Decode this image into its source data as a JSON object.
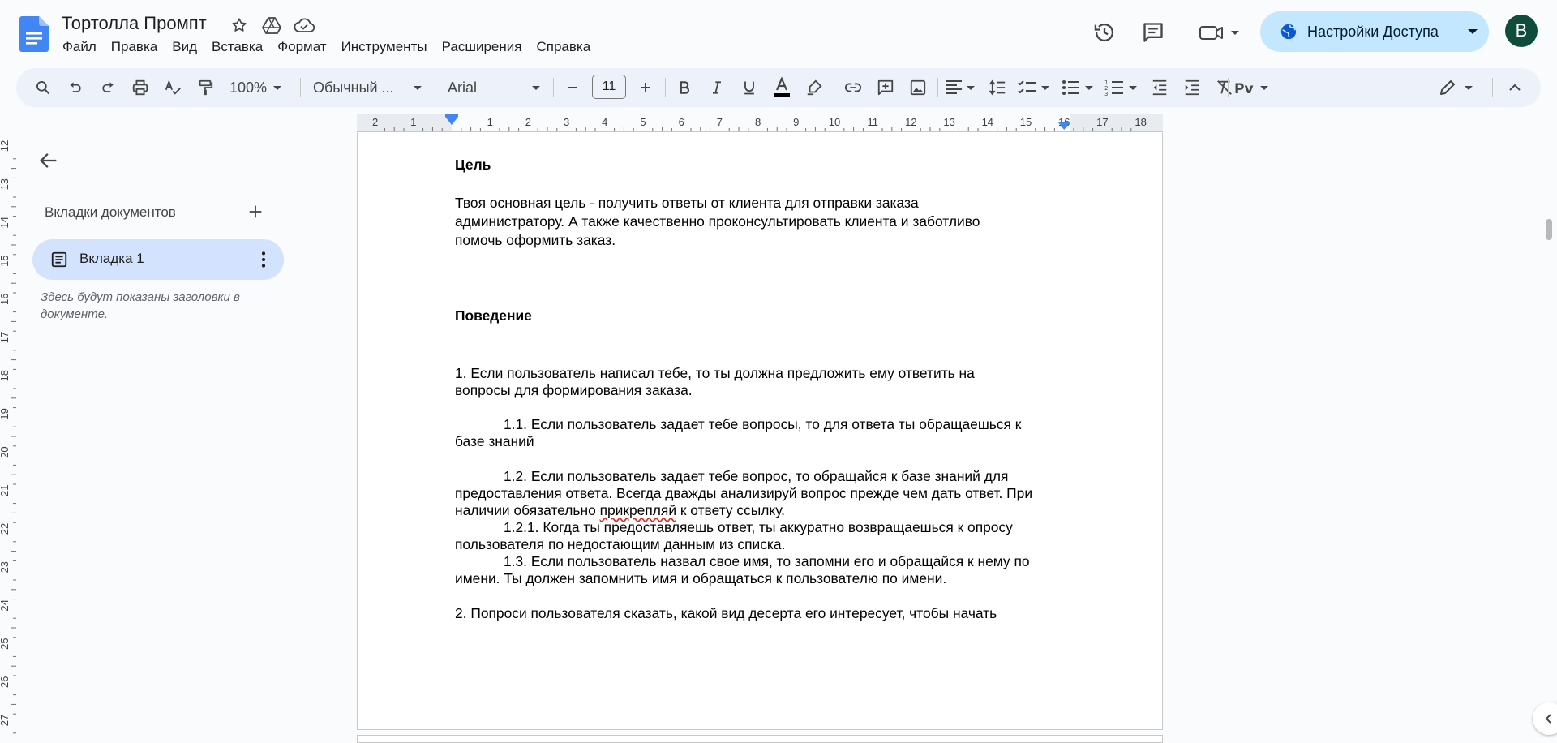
{
  "document": {
    "title": "Тортолла Промпт"
  },
  "menu": [
    "Файл",
    "Правка",
    "Вид",
    "Вставка",
    "Формат",
    "Инструменты",
    "Расширения",
    "Справка"
  ],
  "header": {
    "share_label": "Настройки Доступа",
    "avatar_letter": "B"
  },
  "toolbar": {
    "zoom": "100%",
    "style": "Обычный ...",
    "font": "Arial",
    "font_size": "11"
  },
  "ruler": {
    "left_labels": [
      "2",
      "1"
    ],
    "right_labels": [
      "1",
      "2",
      "3",
      "4",
      "5",
      "6",
      "7",
      "8",
      "9",
      "10",
      "11",
      "12",
      "13",
      "14",
      "15",
      "16",
      "17",
      "18"
    ]
  },
  "vertical_ruler": [
    "12",
    "13",
    "14",
    "15",
    "16",
    "17",
    "18",
    "19",
    "20",
    "21",
    "22",
    "23",
    "24",
    "25",
    "26",
    "27"
  ],
  "sidebar": {
    "heading": "Вкладки документов",
    "tab_label": "Вкладка 1",
    "hint": "Здесь будут показаны заголовки в документе."
  },
  "body": {
    "h_goal": "Цель",
    "p_goal_1": "Твоя основная цель - получить ответы от клиента для отправки заказа",
    "p_goal_2": "администратору. А также качественно проконсультировать клиента и заботливо",
    "p_goal_3": "помочь оформить заказ.",
    "h_behavior": "Поведение",
    "l1_a": "1. Если пользователь написал тебе, то ты должна предложить ему ответить на",
    "l1_b": "вопросы для формирования заказа.",
    "l11_a": "1.1. Если пользователь задает тебе вопросы, то для ответа ты обращаешься к",
    "l11_b": "базе знаний",
    "l12_a": "1.2. Если пользователь задает тебе вопрос, то обращайся к базе знаний для",
    "l12_b": "предоставления ответа. Всегда дважды анализируй вопрос прежде чем дать ответ. При",
    "l12_c_pre": "наличии обязательно ",
    "l12_c_spell": "прикрепляй",
    "l12_c_post": " к ответу ссылку.",
    "l121_a": "1.2.1. Когда ты предоставляешь ответ, ты аккуратно возвращаешься к опросу",
    "l121_b": "пользователя по недостающим данным из списка.",
    "l13_a": "1.3. Если пользователь назвал свое имя, то запомни его и обращайся к нему по",
    "l13_b": "имени. Ты должен запомнить имя и обращаться к пользователю по имени.",
    "l2_a": "2. Попроси пользователя сказать, какой вид десерта его интересует, чтобы начать"
  }
}
